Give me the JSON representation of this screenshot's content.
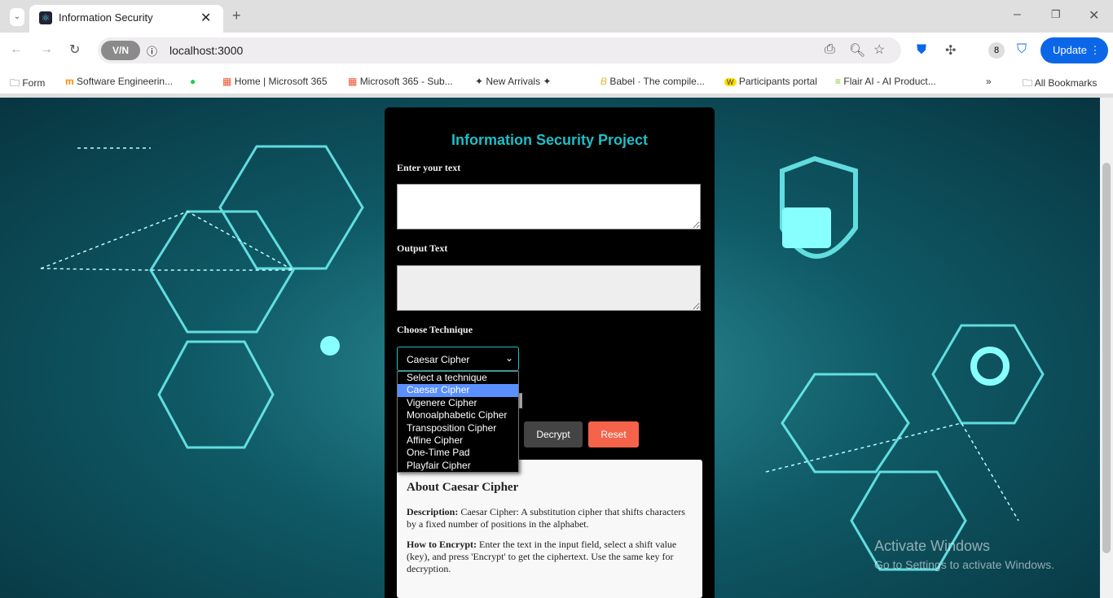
{
  "browser": {
    "tab_title": "Information Security",
    "url": "localhost:3000",
    "vpn_label": "V/N",
    "update_label": "Update",
    "bookmarks": [
      "Form",
      "Software Engineerin...",
      "Home | Microsoft 365",
      "Microsoft 365 - Sub...",
      "New Arrivals",
      "Babel · The compile...",
      "Participants portal",
      "Flair AI - AI Product..."
    ],
    "all_bookmarks": "All Bookmarks"
  },
  "app": {
    "title": "Information Security Project",
    "input_label": "Enter your text",
    "output_label": "Output Text",
    "technique_label": "Choose Technique",
    "selected": "Caesar Cipher",
    "options": [
      "Select a technique",
      "Caesar Cipher",
      "Vigenere Cipher",
      "Monoalphabetic Cipher",
      "Transposition Cipher",
      "Affine Cipher",
      "One-Time Pad",
      "Playfair Cipher"
    ],
    "decrypt_label": "Decrypt",
    "reset_label": "Reset",
    "about": {
      "title": "About Caesar Cipher",
      "desc_label": "Description:",
      "desc": "Caesar Cipher: A substitution cipher that shifts characters by a fixed number of positions in the alphabet.",
      "how_label": "How to Encrypt:",
      "how": "Enter the text in the input field, select a shift value (key), and press 'Encrypt' to get the ciphertext. Use the same key for decryption."
    },
    "colors": {
      "accent": "#1dbfc7",
      "reset": "#f4634a",
      "decrypt": "#444444"
    }
  },
  "watermark": {
    "line1": "Activate Windows",
    "line2": "Go to Settings to activate Windows."
  }
}
